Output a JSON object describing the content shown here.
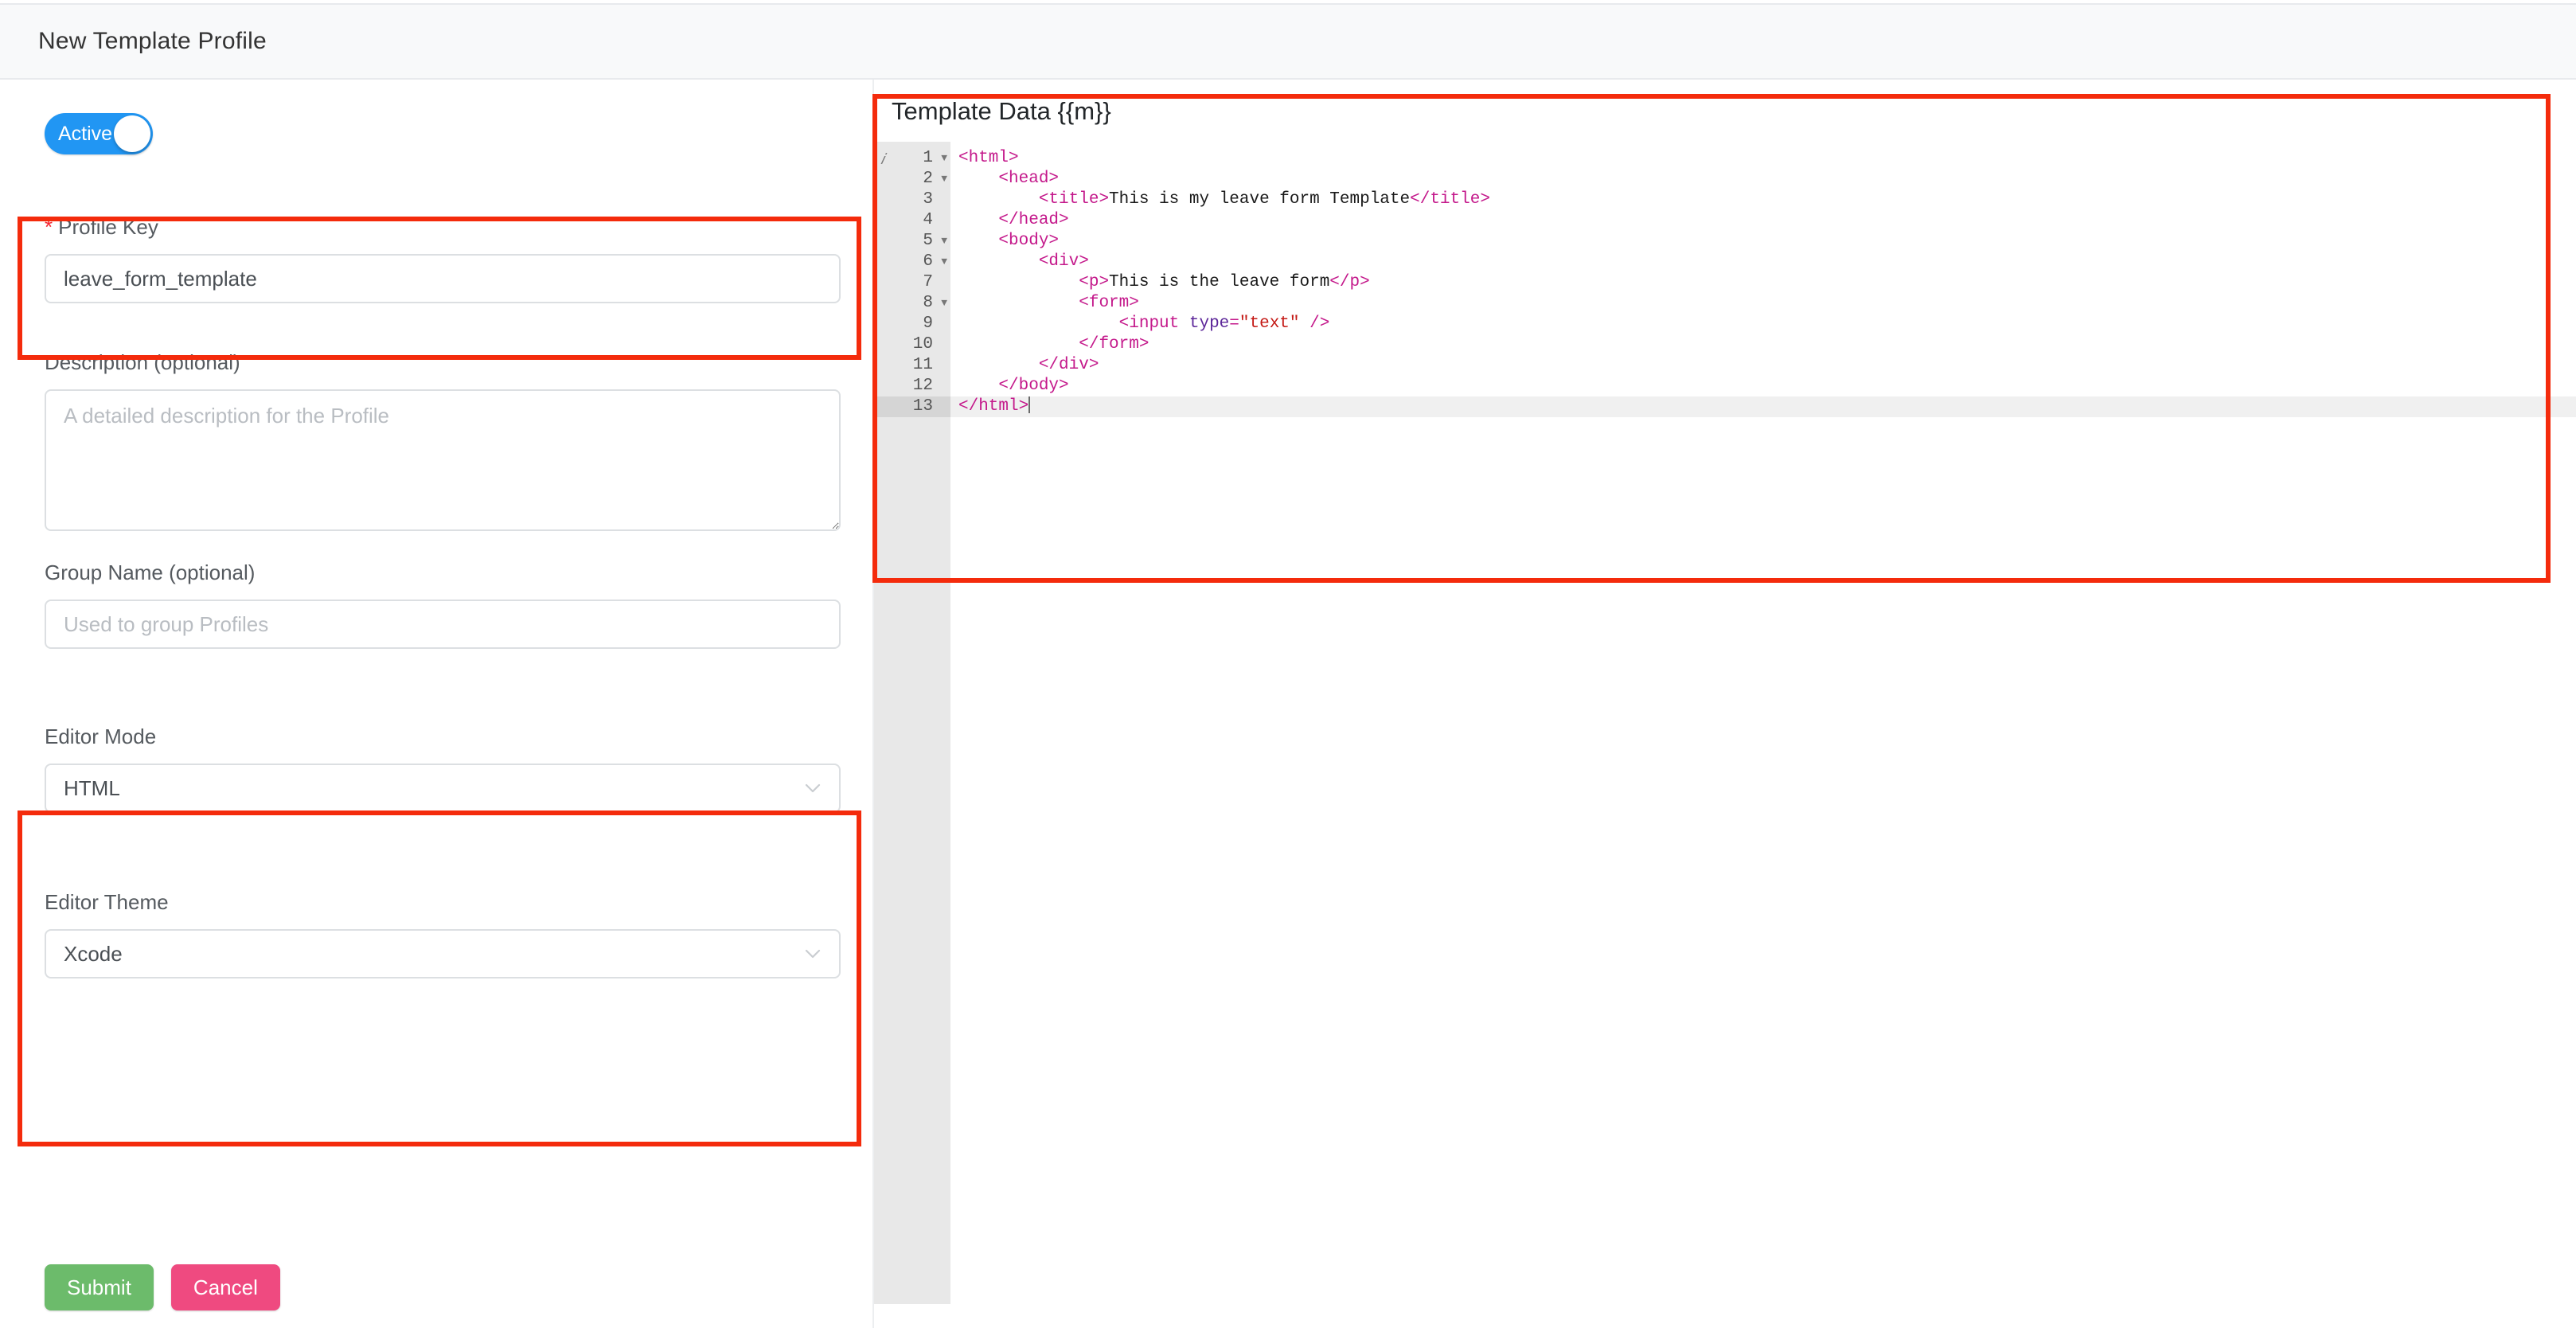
{
  "header": {
    "title": "New Template Profile"
  },
  "form": {
    "active_toggle": {
      "label": "Active",
      "state": "on",
      "color": "#2196f3"
    },
    "profile_key": {
      "label": "Profile Key",
      "required_marker": "*",
      "value": "leave_form_template",
      "placeholder": ""
    },
    "description": {
      "label": "Description (optional)",
      "value": "",
      "placeholder": "A detailed description for the Profile"
    },
    "group_name": {
      "label": "Group Name (optional)",
      "value": "",
      "placeholder": "Used to group Profiles"
    },
    "editor_mode": {
      "label": "Editor Mode",
      "value": "HTML",
      "icon": "chevron-down-icon"
    },
    "editor_theme": {
      "label": "Editor Theme",
      "value": "Xcode",
      "icon": "chevron-down-icon"
    },
    "buttons": {
      "submit": "Submit",
      "cancel": "Cancel",
      "submit_color": "#6cbb6b",
      "cancel_color": "#ef4a80"
    }
  },
  "editor": {
    "title": "Template Data {{m}}",
    "gutter_info_icon": "info-icon",
    "active_line": 13,
    "fold_lines": [
      1,
      2,
      5,
      6,
      8
    ],
    "lines": [
      {
        "n": 1,
        "fold": true,
        "tokens": [
          {
            "t": "tag",
            "s": "<html>"
          }
        ]
      },
      {
        "n": 2,
        "fold": true,
        "tokens": [
          {
            "t": "txt",
            "s": "    "
          },
          {
            "t": "tag",
            "s": "<head>"
          }
        ]
      },
      {
        "n": 3,
        "fold": false,
        "tokens": [
          {
            "t": "txt",
            "s": "        "
          },
          {
            "t": "tag",
            "s": "<title>"
          },
          {
            "t": "txt",
            "s": "This is my leave form Template"
          },
          {
            "t": "tag",
            "s": "</title>"
          }
        ]
      },
      {
        "n": 4,
        "fold": false,
        "tokens": [
          {
            "t": "txt",
            "s": "    "
          },
          {
            "t": "tag",
            "s": "</head>"
          }
        ]
      },
      {
        "n": 5,
        "fold": true,
        "tokens": [
          {
            "t": "txt",
            "s": "    "
          },
          {
            "t": "tag",
            "s": "<body>"
          }
        ]
      },
      {
        "n": 6,
        "fold": true,
        "tokens": [
          {
            "t": "txt",
            "s": "        "
          },
          {
            "t": "tag",
            "s": "<div>"
          }
        ]
      },
      {
        "n": 7,
        "fold": false,
        "tokens": [
          {
            "t": "txt",
            "s": "            "
          },
          {
            "t": "tag",
            "s": "<p>"
          },
          {
            "t": "txt",
            "s": "This is the leave form"
          },
          {
            "t": "tag",
            "s": "</p>"
          }
        ]
      },
      {
        "n": 8,
        "fold": true,
        "tokens": [
          {
            "t": "txt",
            "s": "            "
          },
          {
            "t": "tag",
            "s": "<form>"
          }
        ]
      },
      {
        "n": 9,
        "fold": false,
        "tokens": [
          {
            "t": "txt",
            "s": "                "
          },
          {
            "t": "tag",
            "s": "<input "
          },
          {
            "t": "attr",
            "s": "type"
          },
          {
            "t": "eq",
            "s": "="
          },
          {
            "t": "str",
            "s": "\"text\""
          },
          {
            "t": "tag",
            "s": " />"
          }
        ]
      },
      {
        "n": 10,
        "fold": false,
        "tokens": [
          {
            "t": "txt",
            "s": "            "
          },
          {
            "t": "tag",
            "s": "</form>"
          }
        ]
      },
      {
        "n": 11,
        "fold": false,
        "tokens": [
          {
            "t": "txt",
            "s": "        "
          },
          {
            "t": "tag",
            "s": "</div>"
          }
        ]
      },
      {
        "n": 12,
        "fold": false,
        "tokens": [
          {
            "t": "txt",
            "s": "    "
          },
          {
            "t": "tag",
            "s": "</body>"
          }
        ]
      },
      {
        "n": 13,
        "fold": false,
        "tokens": [
          {
            "t": "tag",
            "s": "</html>"
          }
        ],
        "caret": true
      }
    ],
    "syntax_colors": {
      "tag": "#c4198b",
      "attribute": "#5c2699",
      "string": "#c41a16",
      "text": "#1a1a1a",
      "gutter_bg": "#e8e8e8",
      "active_line_bg": "#f0f0f0"
    }
  },
  "annotations": {
    "color": "#f42b0c",
    "boxes": [
      "profile-key-field",
      "editor-options",
      "template-data-editor"
    ]
  }
}
